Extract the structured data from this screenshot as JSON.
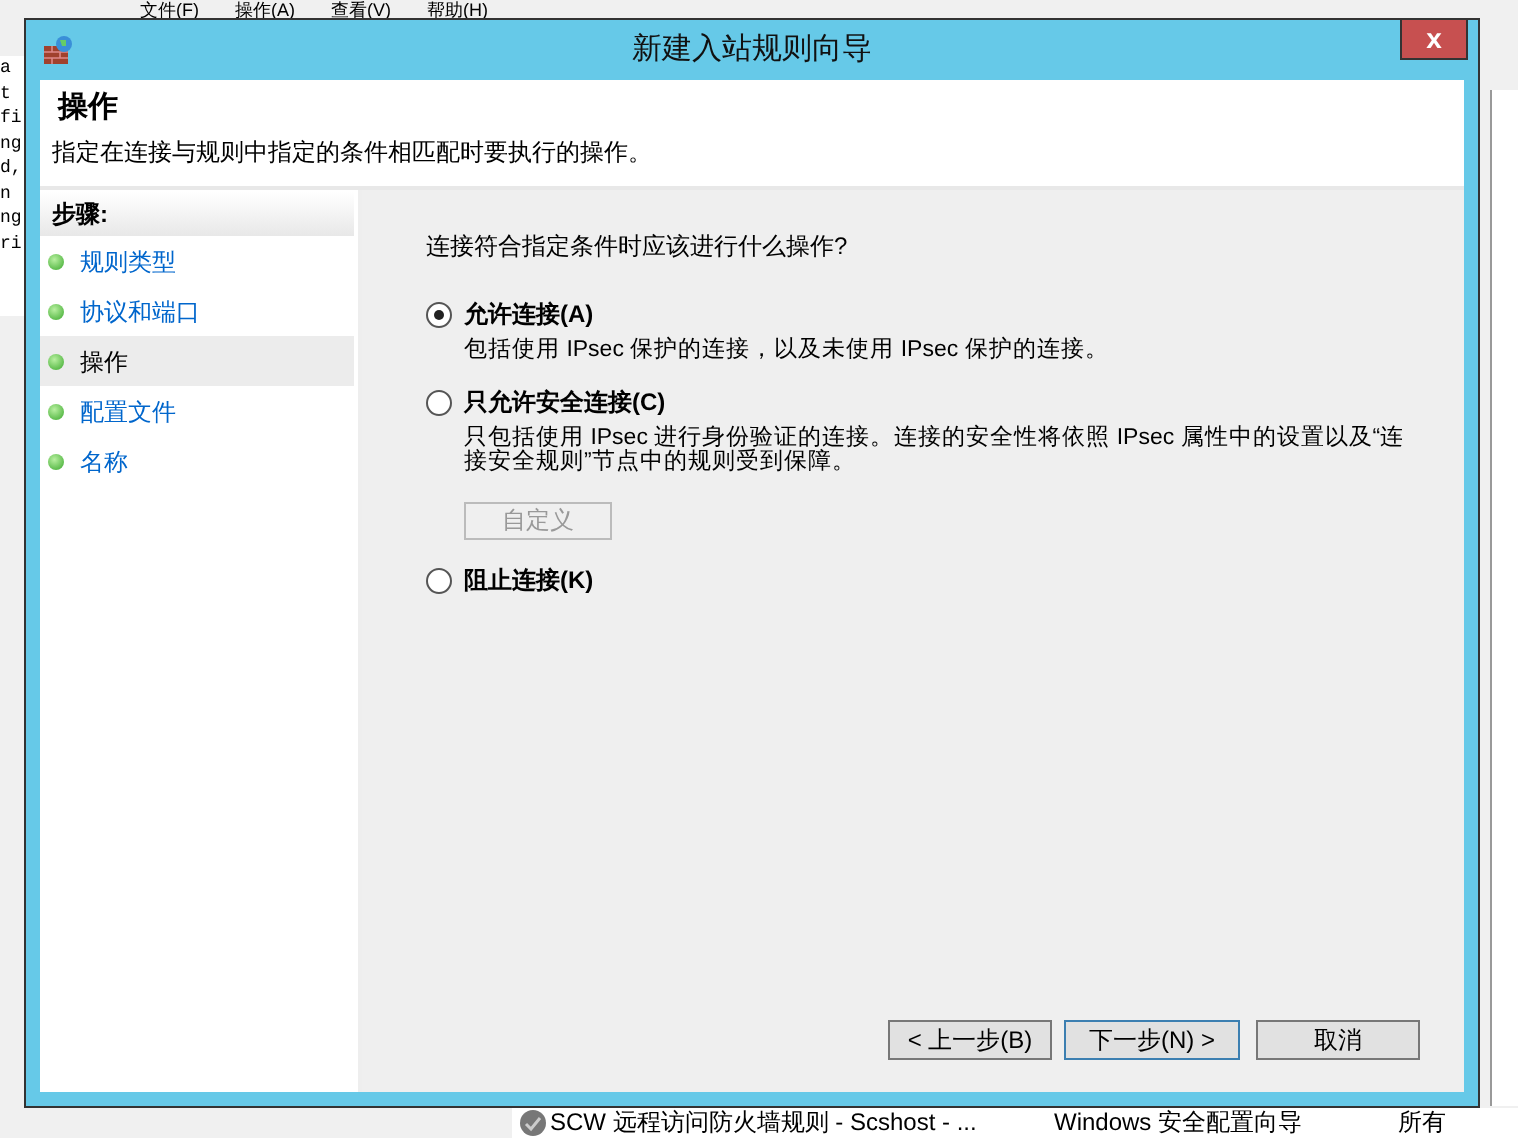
{
  "background_window": {
    "menu": [
      "文件(F)",
      "操作(A)",
      "查看(V)",
      "帮助(H)"
    ],
    "left_fragments": [
      "a",
      "t",
      "fi",
      "ng",
      "d,",
      "n",
      "ng",
      "ri"
    ],
    "bottom_row": {
      "name": "SCW 远程访问防火墙规则 - Scshost - ...",
      "group": "Windows 安全配置向导",
      "profile": "所有"
    }
  },
  "dialog": {
    "title": "新建入站规则向导",
    "close": "x",
    "header": {
      "title": "操作",
      "subtitle": "指定在连接与规则中指定的条件相匹配时要执行的操作。"
    },
    "steps_title": "步骤:",
    "steps": [
      {
        "label": "规则类型",
        "selected": false
      },
      {
        "label": "协议和端口",
        "selected": false
      },
      {
        "label": "操作",
        "selected": true
      },
      {
        "label": "配置文件",
        "selected": false
      },
      {
        "label": "名称",
        "selected": false
      }
    ],
    "question": "连接符合指定条件时应该进行什么操作?",
    "options": [
      {
        "label": "允许连接(A)",
        "description": "包括使用 IPsec 保护的连接，以及未使用 IPsec 保护的连接。",
        "selected": true
      },
      {
        "label": "只允许安全连接(C)",
        "description": "只包括使用 IPsec 进行身份验证的连接。连接的安全性将依照 IPsec 属性中的设置以及“连接安全规则”节点中的规则受到保障。",
        "selected": false,
        "button": {
          "label": "自定义",
          "disabled": true
        }
      },
      {
        "label": "阻止连接(K)",
        "selected": false
      }
    ],
    "buttons": [
      {
        "label": "< 上一步(B)",
        "default": false
      },
      {
        "label": "下一步(N) >",
        "default": true
      },
      {
        "label": "取消",
        "default": false
      }
    ]
  }
}
